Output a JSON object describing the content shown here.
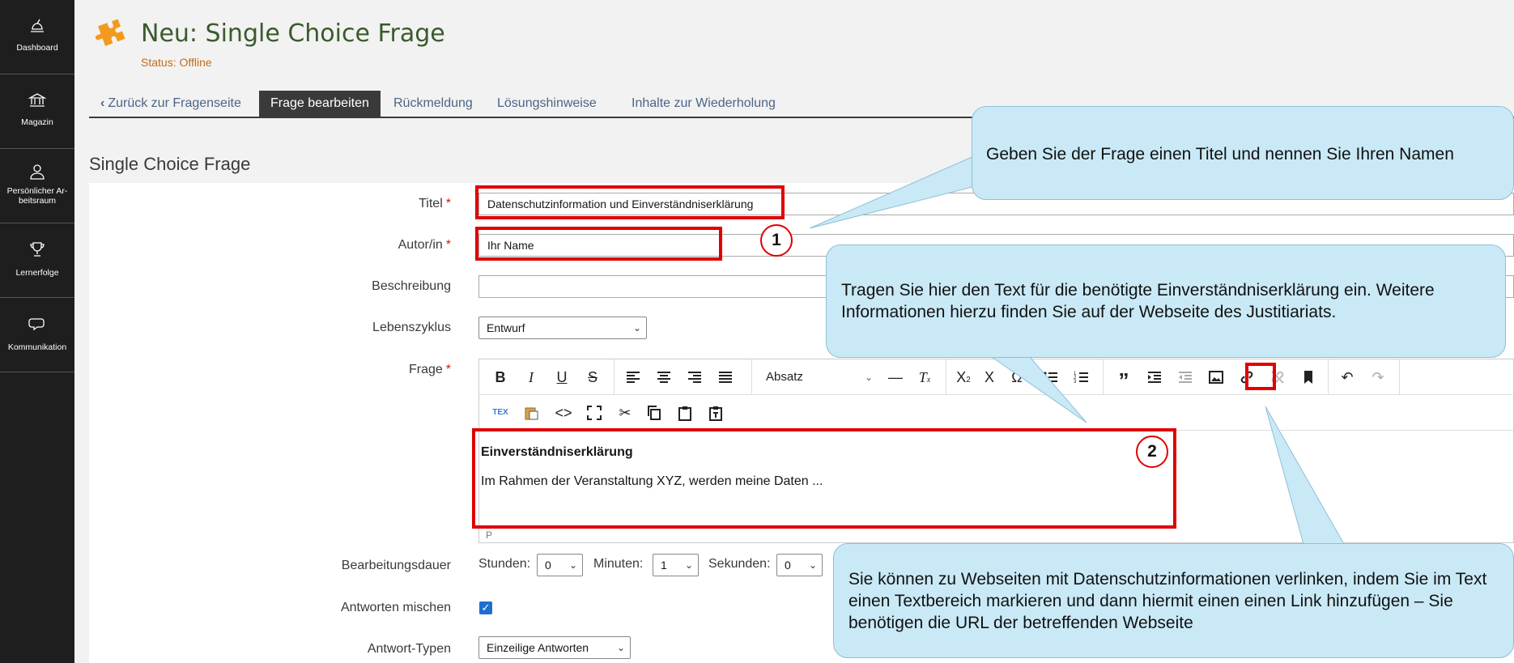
{
  "mainbar": {
    "items": [
      {
        "label": "Dashboard",
        "icon": "dashboard-icon"
      },
      {
        "label": "Magazin",
        "icon": "bank-icon"
      },
      {
        "label": "Persönlicher Ar-beitsraum",
        "icon": "person-icon"
      },
      {
        "label": "Lernerfolge",
        "icon": "trophy-icon"
      },
      {
        "label": "Kommunikation",
        "icon": "chat-icon"
      }
    ]
  },
  "header": {
    "title": "Neu: Single Choice Frage",
    "status": "Status: Offline",
    "icon": "puzzle-icon"
  },
  "tabs": {
    "back": "Zurück zur Fragenseite",
    "edit": "Frage bearbeiten",
    "feedback": "Rückmeldung",
    "hints": "Lösungshinweise",
    "repeat": "Inhalte zur Wiederholung"
  },
  "section": {
    "title": "Single Choice Frage"
  },
  "form": {
    "title_label": "Titel",
    "title_value": "Datenschutzinformation und Einverständniserklärung",
    "author_label": "Autor/in",
    "author_value": "Ihr Name",
    "description_label": "Beschreibung",
    "description_value": "",
    "lifecycle_label": "Lebenszyklus",
    "lifecycle_value": "Entwurf",
    "question_label": "Frage",
    "required_mark": "*",
    "duration_label": "Bearbeitungsdauer",
    "hours_label": "Stunden:",
    "hours_value": "0",
    "minutes_label": "Minuten:",
    "minutes_value": "1",
    "seconds_label": "Sekunden:",
    "seconds_value": "0",
    "shuffle_label": "Antworten mischen",
    "shuffle_checked": true,
    "answer_types_label": "Antwort-Typen",
    "answer_types_value": "Einzeilige Antworten"
  },
  "editor": {
    "format_value": "Absatz",
    "heading": "Einverständniserklärung",
    "paragraph": "Im Rahmen der Veranstaltung XYZ, werden meine Daten ...",
    "status_path": "P"
  },
  "callouts": {
    "c1": "Geben Sie der Frage einen Titel und nennen Sie Ihren Namen",
    "c2": "Tragen Sie hier den Text für die benötigte Einverständniserklärung ein. Weitere Informationen hierzu finden Sie auf der Webseite des Justitiariats.",
    "c3": "Sie können zu Webseiten mit  Datenschutzinformationen verlinken, indem Sie im Text einen Textbereich markieren und dann hiermit einen einen Link hinzufügen – Sie  benötigen die URL der betreffenden Webseite",
    "marker1": "1",
    "marker2": "2"
  },
  "colors": {
    "highlight": "#e00000",
    "callout_bg": "#c9e9f6",
    "mainbar_bg": "#1e1e1e",
    "link": "#4c6586",
    "status": "#c46a1b"
  }
}
